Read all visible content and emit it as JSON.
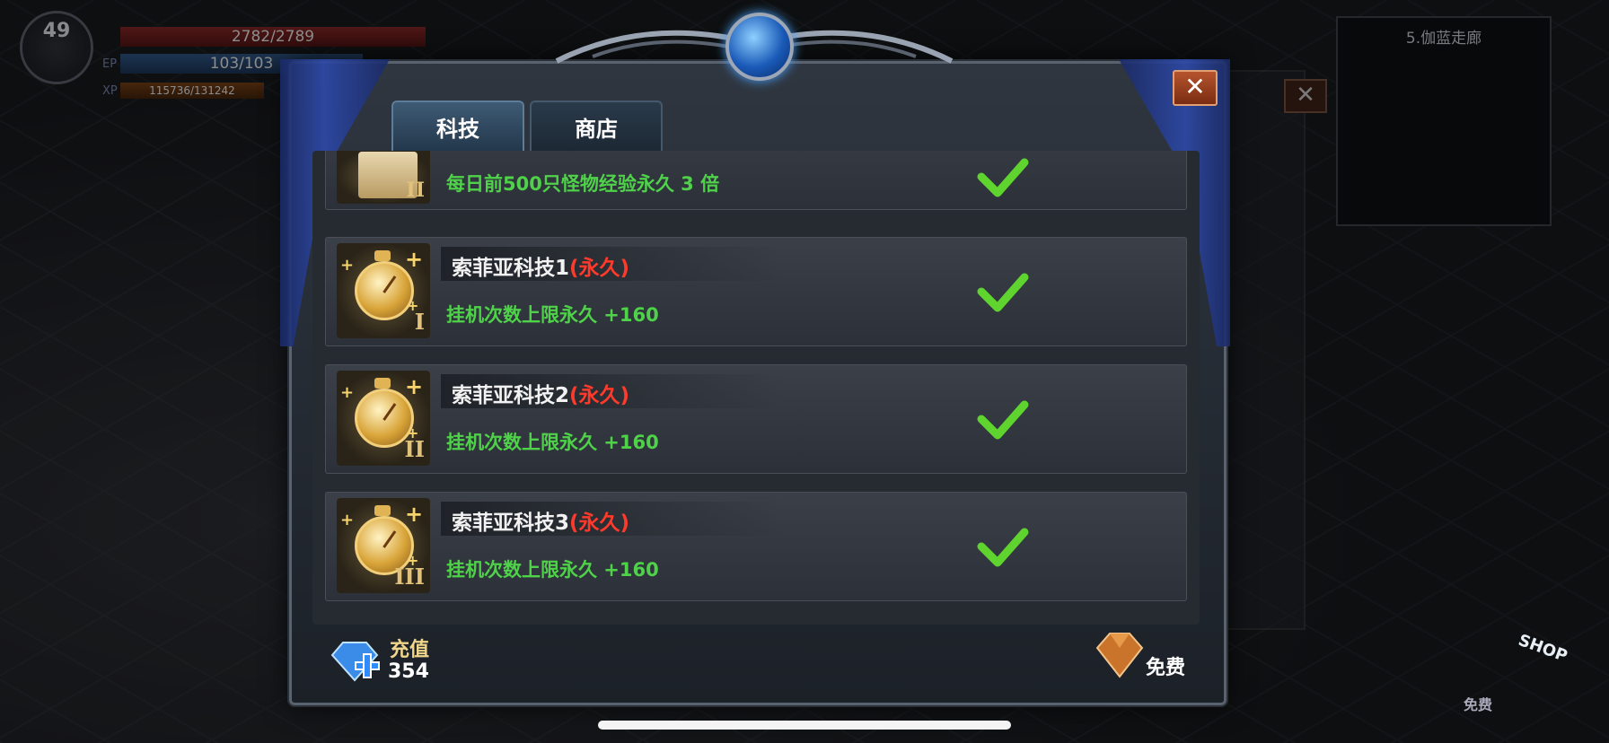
{
  "hud": {
    "level": "49",
    "hp": "2782/2789",
    "ep_label": "EP",
    "ep": "103/103",
    "xp_label": "XP",
    "xp": "115736/131242"
  },
  "minimap": {
    "title": "5.伽蓝走廊"
  },
  "dialog": {
    "tabs": [
      {
        "label": "科技",
        "active": true
      },
      {
        "label": "商店",
        "active": false
      }
    ],
    "close": "✕",
    "items": [
      {
        "name": "",
        "desc": "每日前500只怪物经验永久 3 倍",
        "roman": "II",
        "icon": "scroll-icon"
      },
      {
        "name": "索菲亚科技1",
        "perm": "(永久)",
        "desc": "挂机次数上限永久  +160",
        "roman": "I",
        "icon": "stopwatch-icon"
      },
      {
        "name": "索菲亚科技2",
        "perm": "(永久)",
        "desc": "挂机次数上限永久  +160",
        "roman": "II",
        "icon": "stopwatch-icon"
      },
      {
        "name": "索菲亚科技3",
        "perm": "(永久)",
        "desc": "挂机次数上限永久  +160",
        "roman": "III",
        "icon": "stopwatch-icon"
      }
    ],
    "recharge_label": "充值",
    "recharge_value": "354",
    "free_label": "免费"
  },
  "background": {
    "shop_label": "SHOP",
    "shop_free": "免费"
  },
  "colors": {
    "accent_green": "#4fd24a",
    "perm_red": "#ff3a2a"
  }
}
